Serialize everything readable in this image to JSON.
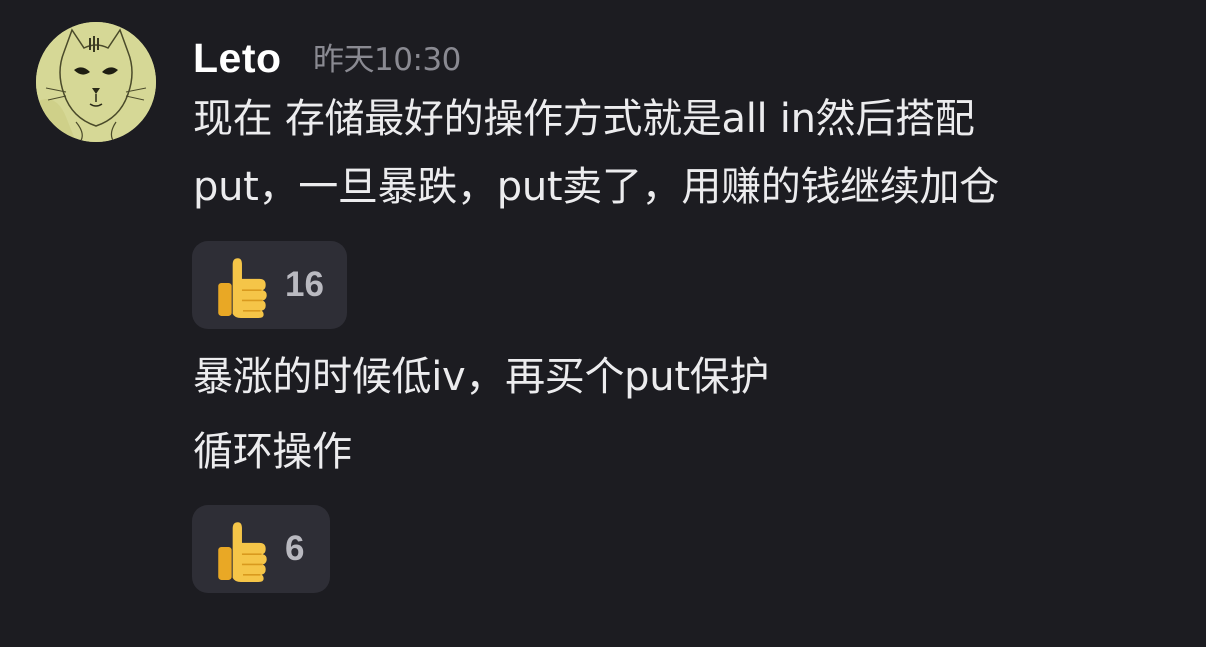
{
  "message": {
    "author": "Leto",
    "timestamp": "昨天10:30",
    "first_block": {
      "lines": [
        "现在 存储最好的操作方式就是all in然后搭配",
        "put，一旦暴跌，put卖了，用赚的钱继续加仓"
      ],
      "reaction": {
        "emoji": "thumbs-up-icon",
        "count": "16"
      }
    },
    "second_block": {
      "lines": [
        "暴涨的时候低iv，再买个put保护",
        "循环操作"
      ],
      "reaction": {
        "emoji": "thumbs-up-icon",
        "count": "6"
      }
    }
  },
  "colors": {
    "background": "#1c1c21",
    "reaction_pill": "#2e2e36",
    "text": "#ececee",
    "timestamp": "#8a8a92"
  }
}
